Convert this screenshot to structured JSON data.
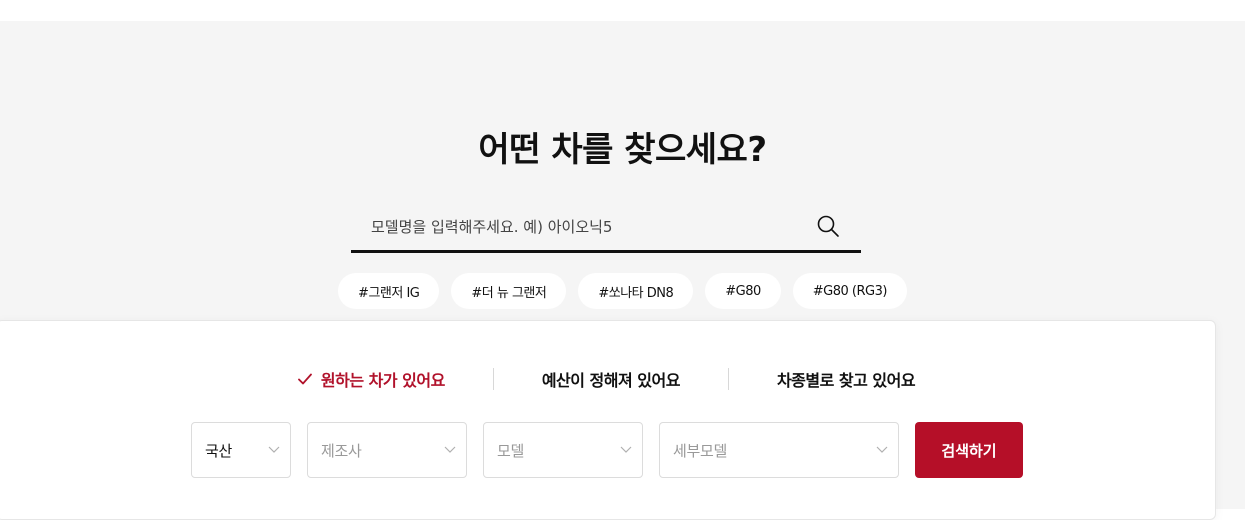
{
  "hero": {
    "title": "어떤 차를 찾으세요?"
  },
  "search": {
    "placeholder": "모델명을 입력해주세요. 예) 아이오닉5",
    "value": "",
    "icon": "search-icon"
  },
  "tags": [
    "#그랜저 IG",
    "#더 뉴 그랜저",
    "#쏘나타 DN8",
    "#G80",
    "#G80 (RG3)"
  ],
  "tabs": [
    {
      "label": "원하는 차가 있어요",
      "active": true,
      "icon": "check-icon"
    },
    {
      "label": "예산이 정해져 있어요",
      "active": false
    },
    {
      "label": "차종별로 찾고 있어요",
      "active": false
    }
  ],
  "filters": {
    "origin": "국산",
    "maker": "제조사",
    "model": "모델",
    "detail_model": "세부모델"
  },
  "submit_label": "검색하기",
  "colors": {
    "accent": "#b50f28",
    "background": "#f5f5f5",
    "text": "#111111"
  }
}
